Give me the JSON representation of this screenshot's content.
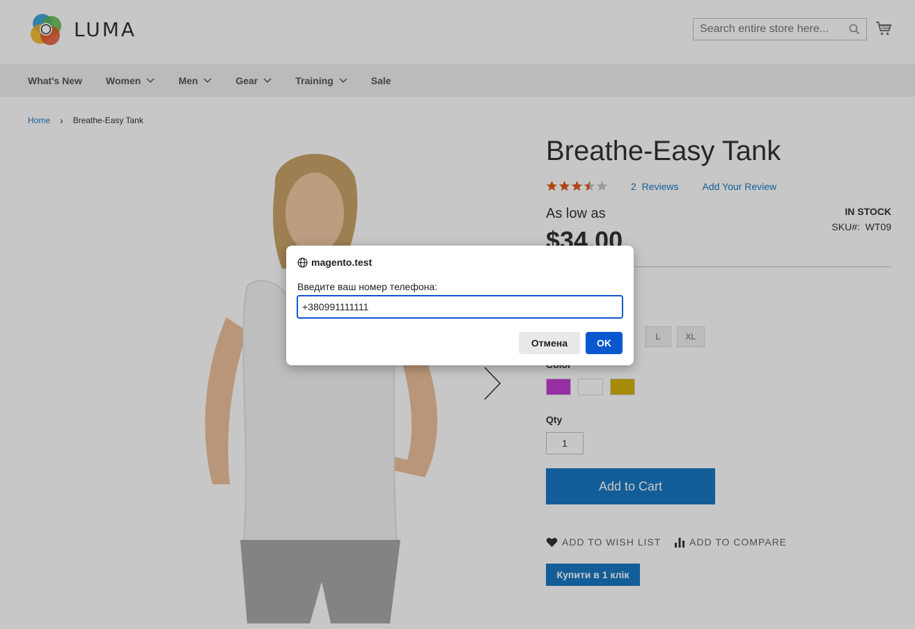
{
  "brand": {
    "name": "LUMA"
  },
  "search": {
    "placeholder": "Search entire store here..."
  },
  "nav": [
    {
      "label": "What's New",
      "has_dropdown": false
    },
    {
      "label": "Women",
      "has_dropdown": true
    },
    {
      "label": "Men",
      "has_dropdown": true
    },
    {
      "label": "Gear",
      "has_dropdown": true
    },
    {
      "label": "Training",
      "has_dropdown": true
    },
    {
      "label": "Sale",
      "has_dropdown": false
    }
  ],
  "breadcrumb": {
    "home": "Home",
    "separator": "›",
    "current": "Breathe-Easy Tank"
  },
  "product": {
    "title": "Breathe-Easy Tank",
    "rating_stars": 3.5,
    "rating_max": 5,
    "reviews_count": "2",
    "reviews_word": "Reviews",
    "add_review": "Add Your Review",
    "as_low_as": "As low as",
    "price": "$34.00",
    "stock": "IN STOCK",
    "sku_label": "SKU#:",
    "sku": "WT09",
    "sizes": [
      "L",
      "XL"
    ],
    "color_label": "Color",
    "colors": [
      "#c33cd2",
      "#ffffff",
      "#d6b20b"
    ],
    "qty_label": "Qty",
    "qty": "1",
    "add_to_cart": "Add to Cart",
    "wish_list": "ADD TO WISH LIST",
    "compare": "ADD TO COMPARE",
    "buy_one_click": "Купити в 1 клік"
  },
  "dialog": {
    "origin": "magento.test",
    "message": "Введите ваш номер телефона:",
    "value": "+380991111111",
    "cancel": "Отмена",
    "ok": "OK"
  },
  "colors": {
    "accent": "#1979c3",
    "dialog_accent": "#0b57d0",
    "star": "#e05a1d"
  }
}
